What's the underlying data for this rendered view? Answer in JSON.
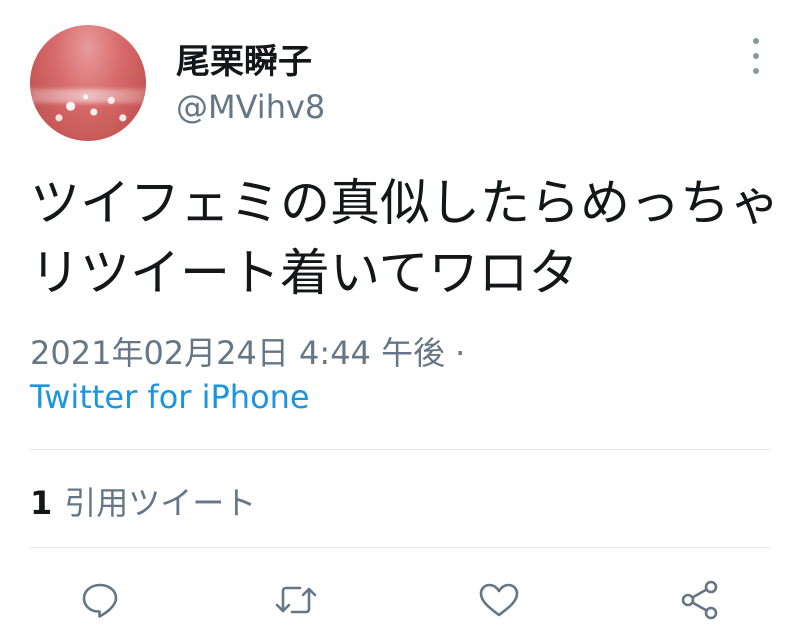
{
  "user": {
    "display_name": "尾栗瞬子",
    "handle": "@MVihv8"
  },
  "tweet": {
    "text": "ツイフェミの真似したらめっちゃリツイート着いてワロタ",
    "timestamp": "2021年02月24日 4:44 午後",
    "separator": "·",
    "source": "Twitter for iPhone"
  },
  "stats": {
    "quote_count": "1",
    "quote_label": "引用ツイート"
  },
  "actions": {
    "icons": [
      "reply-icon",
      "retweet-icon",
      "like-icon",
      "share-icon"
    ]
  },
  "colors": {
    "text": "#14171a",
    "secondary": "#657786",
    "link": "#1b95e0",
    "divider": "#e1e8ed",
    "icon": "#657786"
  }
}
